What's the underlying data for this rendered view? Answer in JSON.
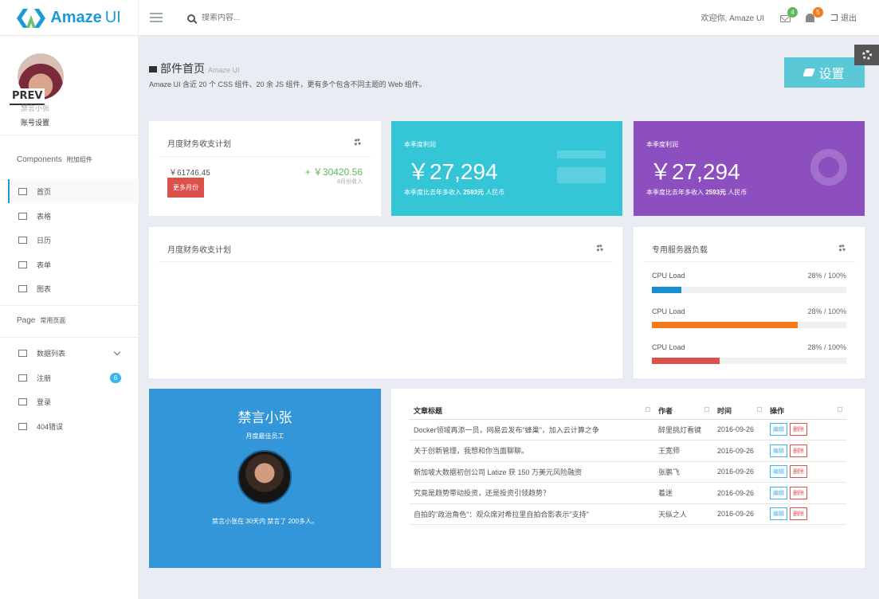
{
  "brand": {
    "name": "Amaze",
    "suffix": "UI"
  },
  "search": {
    "placeholder": "搜索内容..."
  },
  "header": {
    "welcome": "欢迎你, Amaze UI",
    "mail_count": "4",
    "notice_count": "5",
    "logout": "退出"
  },
  "sidebar": {
    "overlay_text": "PREV",
    "user_status": "禁言小张",
    "account_settings": "账号设置",
    "components_title": "Components",
    "components_sub": "附加组件",
    "nav": [
      {
        "label": "首页"
      },
      {
        "label": "表格"
      },
      {
        "label": "日历"
      },
      {
        "label": "表单"
      },
      {
        "label": "图表"
      }
    ],
    "page_title": "Page",
    "page_sub": "常用页面",
    "page_nav": [
      {
        "label": "数据列表"
      },
      {
        "label": "注册",
        "badge": "6"
      },
      {
        "label": "登录"
      },
      {
        "label": "404错误"
      }
    ]
  },
  "page": {
    "title": "部件首页",
    "title_sub": "Amaze UI",
    "description": "Amaze UI 含近 20 个 CSS 组件、20 余 JS 组件，更有多个包含不同主题的 Web 组件。",
    "settings_button": "设置"
  },
  "finance": {
    "title": "月度财务收支计划",
    "amount_left": "￥61746.45",
    "amount_right": "+ ￥30420.56",
    "right_sub": "8月份收入",
    "more_button": "更多月份"
  },
  "stat_cyan": {
    "label": "本季度利润",
    "value": "￥27,294",
    "desc_prefix": "本季度比去年多收入 ",
    "desc_bold": "2593元",
    "desc_suffix": " 人民币",
    "color": "#34c5d6"
  },
  "stat_purple": {
    "label": "本季度利润",
    "value": "￥27,294",
    "desc_prefix": "本季度比去年多收入 ",
    "desc_bold": "2593元",
    "desc_suffix": " 人民币",
    "color": "#8d4ebf"
  },
  "finance_plan": {
    "title": "月度财务收支计划"
  },
  "server": {
    "title": "专用服务器负载",
    "loads": [
      {
        "label": "CPU Load",
        "value_text": "28% / 100%",
        "fill": 0.15,
        "color": "#1a8fd0"
      },
      {
        "label": "CPU Load",
        "value_text": "28% / 100%",
        "fill": 0.75,
        "color": "#f37b1d"
      },
      {
        "label": "CPU Load",
        "value_text": "28% / 100%",
        "fill": 0.35,
        "color": "#dd514c"
      }
    ]
  },
  "profile": {
    "name": "禁言小张",
    "role": "月度最佳员工",
    "bio": "禁言小张在 30天内 禁言了 200多人。"
  },
  "articles": {
    "columns": [
      "文章标题",
      "作者",
      "时间",
      "操作"
    ],
    "edit": "编辑",
    "delete": "删除",
    "rows": [
      {
        "title": "Docker领域再添一员，网易云发布\"蜂巢\"，加入云计算之争",
        "author": "醉里挑灯看键",
        "date": "2016-09-26"
      },
      {
        "title": "关于创新管理，我想和你当面聊聊。",
        "author": "王宽师",
        "date": "2016-09-26"
      },
      {
        "title": "新加坡大数据初创公司 Latize 获 150 万美元风险融资",
        "author": "张鹏飞",
        "date": "2016-09-26"
      },
      {
        "title": "究竟是趋势带动投资，还是投资引领趋势？",
        "author": "着迷",
        "date": "2016-09-26"
      },
      {
        "title": "自拍的\"政治角色\"：观众席对希拉里自拍合影表示\"支持\"",
        "author": "天纵之人",
        "date": "2016-09-26"
      }
    ]
  }
}
